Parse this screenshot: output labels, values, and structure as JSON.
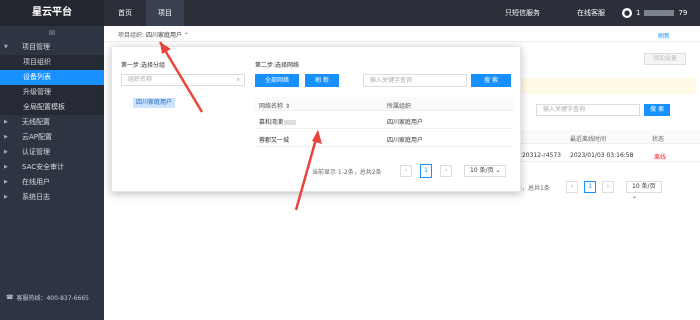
{
  "topbar": {
    "brand": "星云平台",
    "nav_home": "首页",
    "nav_project": "项目",
    "sms_service": "只短信服务",
    "online_service": "在线客服",
    "user_name": "1",
    "user_suffix": "79"
  },
  "sidebar": {
    "collapse": "III",
    "items": [
      {
        "label": "项目管理"
      },
      {
        "label": "项目组织"
      },
      {
        "label": "设备列表"
      },
      {
        "label": "升级管理"
      },
      {
        "label": "全局配置模板"
      },
      {
        "label": "无线配置"
      },
      {
        "label": "云AP配置"
      },
      {
        "label": "认证管理"
      },
      {
        "label": "SAC安全审计"
      },
      {
        "label": "在线用户"
      },
      {
        "label": "系统日志"
      }
    ],
    "hotline": "客服热线：400-837-6665"
  },
  "breadcrumb": {
    "label": "项目组织:",
    "value": "四川家庭用户"
  },
  "refresh": "刷新",
  "add_device": "添加设备",
  "background_table": {
    "search_placeholder": "输入关键字查询",
    "search_label": "搜 索",
    "headers": [
      "最近离线时间",
      "状态"
    ],
    "row": {
      "mac": "-220312-r4573",
      "time": "2023/01/03 03:16:58",
      "status": "离线"
    },
    "pager_total": "条，总共1条",
    "page": "1",
    "page_size": "10 条/页"
  },
  "dropdown": {
    "step1": "第一步:选择分组",
    "org_placeholder": "组织名称",
    "org_item": "四川家庭用户",
    "step2": "第二步:选择网络",
    "all_networks": "全部网络",
    "refresh": "刷 新",
    "net_placeholder": "输入关键字查询",
    "search": "搜 索",
    "headers": [
      "网络名称",
      "所属组织"
    ],
    "rows": [
      {
        "name": "慕和湾澳",
        "org": "四川家庭用户"
      },
      {
        "name": "蓉郡又一城",
        "org": "四川家庭用户"
      }
    ],
    "pager_total": "当前显示 1-2条，总共2条",
    "page": "1",
    "page_size": "10 条/页"
  },
  "colors": {
    "accent": "#1890ff",
    "topbar": "#2b2f3a",
    "sidebar": "#2f3442",
    "arrow": "#e8453c",
    "offline": "#f5222d"
  },
  "icons": {
    "collapse": "menu-icon",
    "search": "search-icon",
    "chevron": "chevron-up-icon",
    "user": "user-icon",
    "phone": "phone-icon"
  }
}
